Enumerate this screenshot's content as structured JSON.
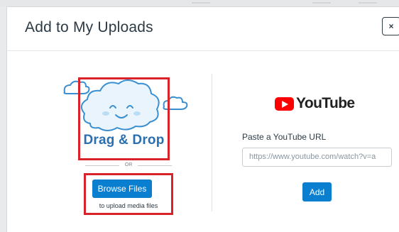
{
  "modal": {
    "title": "Add to My Uploads",
    "close_label": "×"
  },
  "upload": {
    "drag_drop_label": "Drag & Drop",
    "or_label": "OR",
    "browse_label": "Browse Files",
    "browse_sub": "to upload media files"
  },
  "youtube": {
    "logo_text": "YouTube",
    "url_label": "Paste a YouTube URL",
    "url_placeholder": "https://www.youtube.com/watch?v=a",
    "add_label": "Add"
  },
  "colors": {
    "accent": "#0a7fcf",
    "highlight": "#d9232a",
    "youtube_red": "#ff0000",
    "drag_drop_text": "#2a6fb0"
  },
  "icons": [
    "cloud-icon",
    "youtube-play-icon",
    "close-icon"
  ]
}
